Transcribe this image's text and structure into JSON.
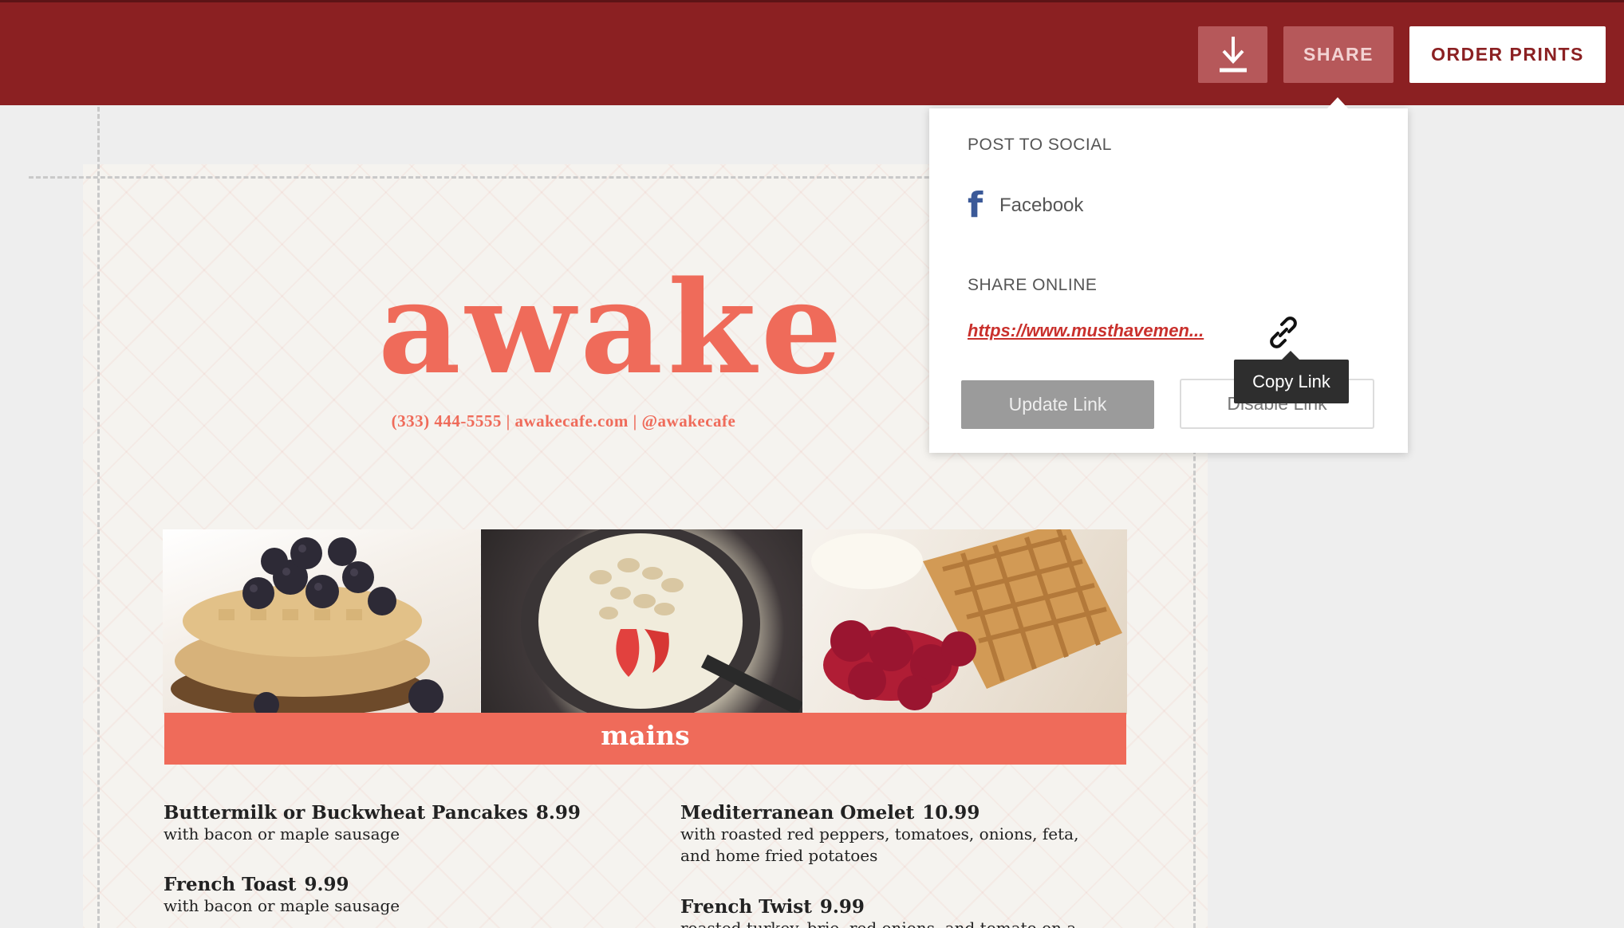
{
  "toolbar": {
    "download_icon": "download-icon",
    "share_label": "SHARE",
    "order_prints_label": "ORDER PRINTS"
  },
  "menu": {
    "title": "awake",
    "contact": "(333) 444-5555 | awakecafe.com | @awakecafe",
    "section": "mains",
    "items": [
      {
        "name": "Buttermilk or Buckwheat Pancakes",
        "price": "8.99",
        "desc": "with bacon or maple sausage"
      },
      {
        "name": "French Toast",
        "price": "9.99",
        "desc": "with bacon or maple sausage"
      },
      {
        "name": "Mediterranean Omelet",
        "price": "10.99",
        "desc": "with roasted red peppers, tomatoes, onions, feta,\nand home fried potatoes"
      },
      {
        "name": "French Twist",
        "price": "9.99",
        "desc": "roasted turkey, brie, red onions, and tomato on a"
      }
    ]
  },
  "share_panel": {
    "post_to_social_label": "POST TO SOCIAL",
    "facebook_label": "Facebook",
    "share_online_label": "SHARE ONLINE",
    "link_url": "https://www.musthavemen...",
    "copy_link_tooltip": "Copy Link",
    "update_link_label": "Update Link",
    "disable_link_label": "Disable Link"
  },
  "colors": {
    "topbar": "#8b2022",
    "accent": "#ef6b5a",
    "link": "#c9302c",
    "facebook": "#3b5998"
  }
}
